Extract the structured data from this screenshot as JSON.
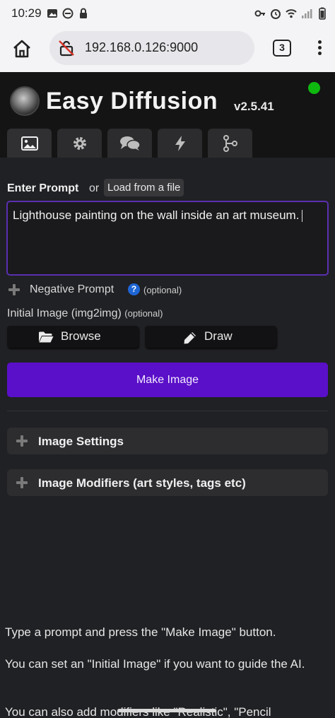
{
  "status_bar": {
    "time": "10:29",
    "left_icons": [
      "image-icon",
      "do-not-disturb-icon",
      "lock-icon"
    ],
    "right_icons": [
      "key-icon",
      "alarm-icon",
      "wifi-icon",
      "signal-icon",
      "battery-icon"
    ]
  },
  "browser": {
    "url": "192.168.0.126:9000",
    "tab_count": "3"
  },
  "app": {
    "title": "Easy Diffusion",
    "version": "v2.5.41",
    "status_color": "#0fb80f",
    "tabs": [
      {
        "icon": "image-icon",
        "active": true
      },
      {
        "icon": "gear-icon",
        "active": false
      },
      {
        "icon": "chat-icon",
        "active": false
      },
      {
        "icon": "lightning-icon",
        "active": false
      },
      {
        "icon": "branch-icon",
        "active": false
      }
    ]
  },
  "prompt": {
    "label": "Enter Prompt",
    "or_text": "or",
    "load_button": "Load from a file",
    "value": "Lighthouse painting on the wall inside an art museum."
  },
  "negative_prompt": {
    "label": "Negative Prompt",
    "help": "?",
    "optional": "(optional)"
  },
  "initial_image": {
    "label": "Initial Image (img2img)",
    "optional": "(optional)",
    "browse_button": "Browse",
    "draw_button": "Draw"
  },
  "make_image_button": "Make Image",
  "sections": [
    {
      "label": "Image Settings"
    },
    {
      "label": "Image Modifiers (art styles, tags etc)"
    }
  ],
  "help_text": [
    "Type a prompt and press the \"Make Image\" button.",
    "You can set an \"Initial Image\" if you want to guide the AI.",
    "You can also add modifiers like \"Realistic\", \"Pencil"
  ],
  "colors": {
    "accent": "#5a0fc8",
    "prompt_border": "#5a2fb0",
    "help_badge": "#1e66d6"
  }
}
